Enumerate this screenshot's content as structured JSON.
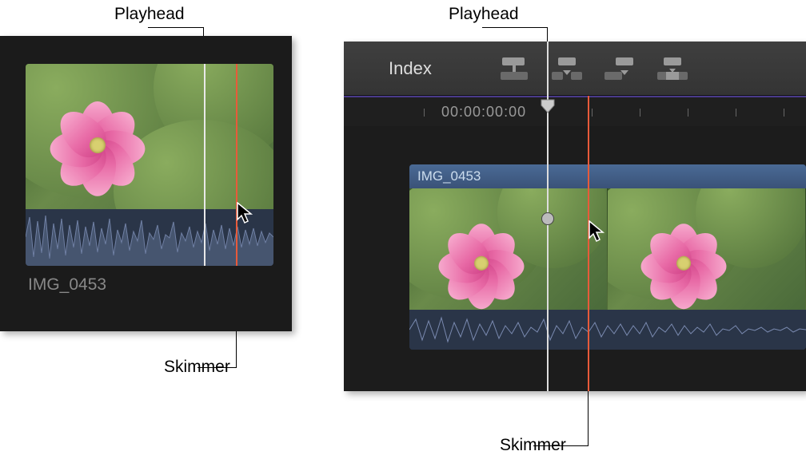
{
  "labels": {
    "playhead_left": "Playhead",
    "playhead_right": "Playhead",
    "skimmer_left": "Skimmer",
    "skimmer_right": "Skimmer"
  },
  "browser": {
    "clip_name": "IMG_0453"
  },
  "timeline": {
    "index_button": "Index",
    "timecode": "00:00:00:00",
    "clip_name": "IMG_0453"
  }
}
